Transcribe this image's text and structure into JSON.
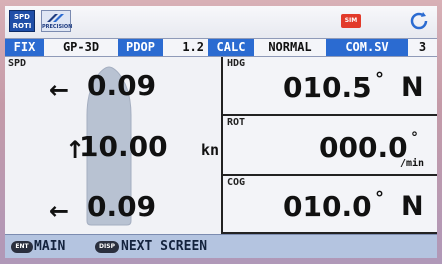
{
  "topbar": {
    "mode_icon": {
      "line1": "SPD",
      "line2": "ROTI"
    },
    "precision_label": "PRECISION",
    "sim_label": "SIM",
    "refresh_icon": "refresh-icon"
  },
  "status": {
    "fix_label": "FIX",
    "fix_value": "GP-3D",
    "pdop_label": "PDOP",
    "pdop_value": "1.2",
    "calc_label": "CALC",
    "calc_value": "NORMAL",
    "comsv_label": "COM.SV",
    "comsv_value": "3"
  },
  "spd": {
    "label": "SPD",
    "fore": {
      "arrow": "←",
      "value": "0.09"
    },
    "center": {
      "arrow": "↑",
      "value": "10.00"
    },
    "aft": {
      "arrow": "←",
      "value": "0.09"
    },
    "unit": "kn"
  },
  "hdg": {
    "label": "HDG",
    "value": "010.5",
    "degree": "°",
    "ref": "N"
  },
  "rot": {
    "label": "ROT",
    "value": "000.0",
    "degree": "°",
    "unit": "/min"
  },
  "cog": {
    "label": "COG",
    "value": "010.0",
    "degree": "°",
    "ref": "N"
  },
  "softkeys": [
    {
      "key": "ENT",
      "label": "MAIN"
    },
    {
      "key": "DISP",
      "label": "NEXT SCREEN"
    }
  ],
  "colors": {
    "label_blue": "#2b6bd1",
    "sim_red": "#e23a2a",
    "bottom_bar": "#b4c4e0"
  }
}
